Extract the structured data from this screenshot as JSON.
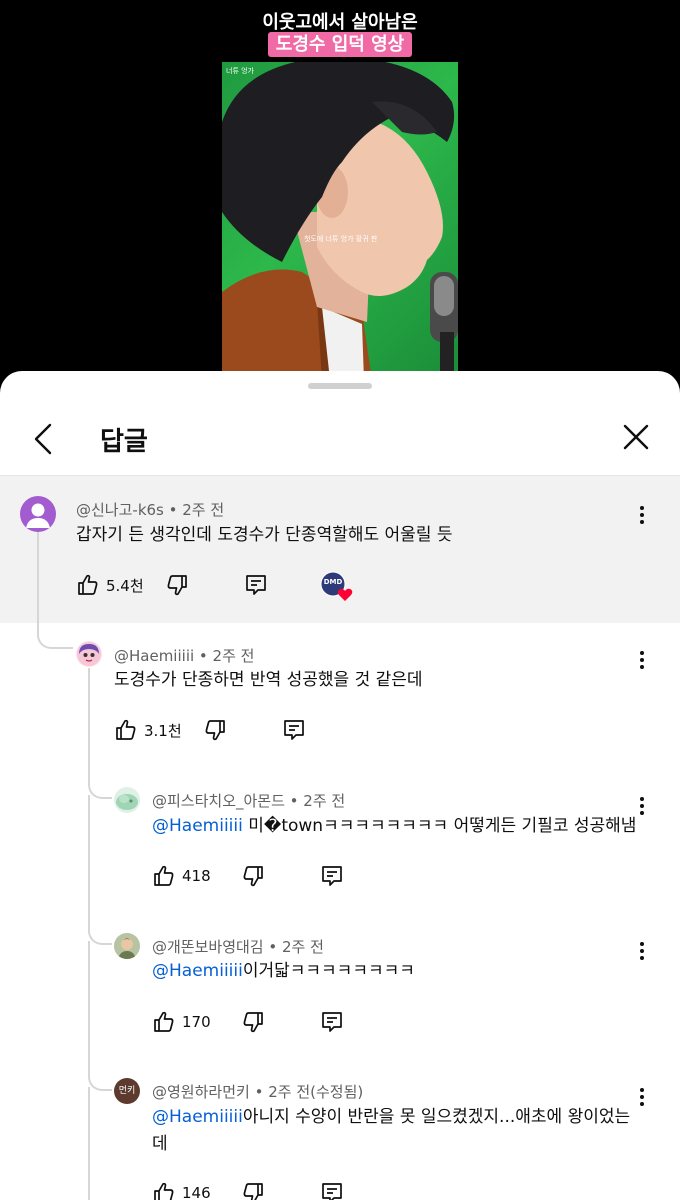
{
  "video": {
    "title_line1": "이웃고에서 살아남은",
    "title_line2": "도경수 입덕 영상",
    "caption": "첫도에 너튜 엉가 황귀 판",
    "badge": "너튜 엉가"
  },
  "sheet": {
    "title": "답글"
  },
  "parent_comment": {
    "author": "@신나고-k6s",
    "time": "2주 전",
    "text": "갑자기 든 생각인데 도경수가 단종역할해도 어울릴 듯",
    "likes": "5.4천",
    "creator_badge": "DMD"
  },
  "replies": [
    {
      "author": "@Haemiiiii",
      "time": "2주 전",
      "mention": "",
      "text": "도경수가 단종하면 반역 성공했을 것 같은데",
      "likes": "3.1천"
    },
    {
      "author": "@피스타치오_아몬드",
      "time": "2주 전",
      "mention": "@Haemiiiii",
      "text": " 미�townㅋㅋㅋㅋㅋㅋㅋㅋ 어떻게든 기필코 성공해냄",
      "likes": "418"
    },
    {
      "author": "@개똔보바영대김",
      "time": "2주 전",
      "mention": "@Haemiiiii",
      "text": "이거닯ㅋㅋㅋㅋㅋㅋㅋㅋ",
      "likes": "170"
    },
    {
      "author": "@영원하라먼키",
      "time": "2주 전(수정됨)",
      "mention": "@Haemiiiii",
      "text": "아니지 수양이 반란을 못 일으켰겠지...애초에 왕이었는데",
      "likes": "146",
      "avatar_label": "먼키"
    }
  ],
  "colors": {
    "mention": "#065fd4",
    "parent_bg": "#f2f2f2",
    "parent_avatar": "#a25ccf",
    "heart": "#ff0033"
  }
}
